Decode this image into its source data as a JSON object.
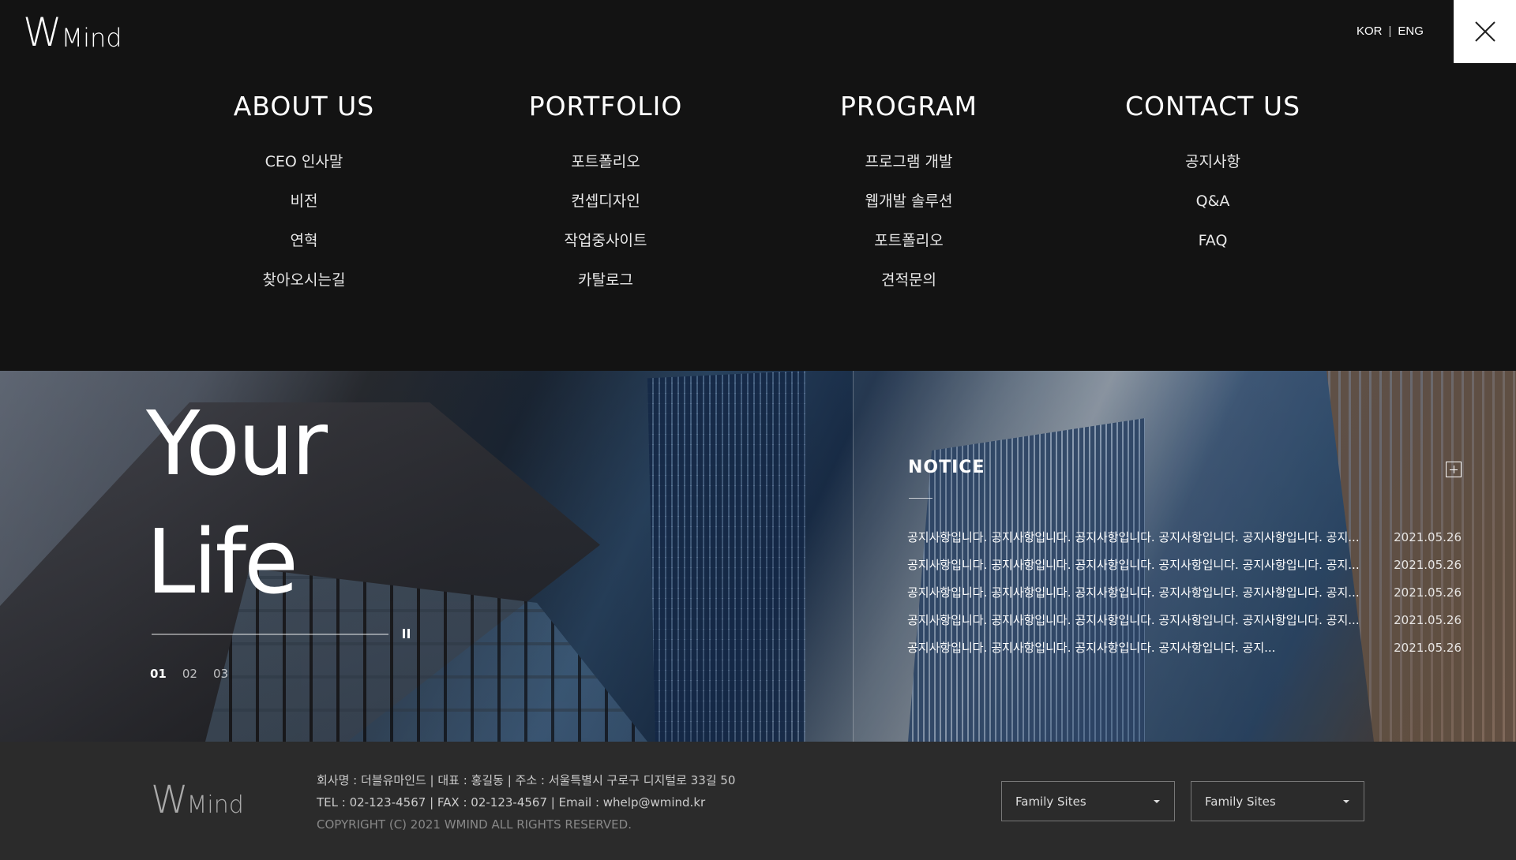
{
  "header": {
    "logo": {
      "w": "W",
      "mind": "Mind"
    },
    "lang": {
      "kor": "KOR",
      "sep": "|",
      "eng": "ENG"
    }
  },
  "menu": {
    "about": {
      "title": "ABOUT US",
      "items": [
        "CEO 인사말",
        "비전",
        "연혁",
        "찾아오시는길"
      ]
    },
    "portfolio": {
      "title": "PORTFOLIO",
      "items": [
        "포트폴리오",
        "컨셉디자인",
        "작업중사이트",
        "카탈로그"
      ]
    },
    "program": {
      "title": "PROGRAM",
      "items": [
        "프로그램 개발",
        "웹개발 솔루션",
        "포트폴리오",
        "견적문의"
      ]
    },
    "contact": {
      "title": "CONTACT US",
      "items": [
        "공지사항",
        "Q&A",
        "FAQ"
      ]
    }
  },
  "hero": {
    "title_line1": "Your",
    "title_line2": "Life",
    "progress_fraction": 0.0,
    "pager": [
      "01",
      "02",
      "03"
    ]
  },
  "notice": {
    "title": "NOTICE",
    "items": [
      {
        "text": "공지사항입니다. 공지사항입니다. 공지사항입니다. 공지사항입니다.  공지사항입니다.  공지...",
        "date": "2021.05.26"
      },
      {
        "text": "공지사항입니다. 공지사항입니다. 공지사항입니다. 공지사항입니다.  공지사항입니다. 공지...",
        "date": "2021.05.26"
      },
      {
        "text": "공지사항입니다. 공지사항입니다. 공지사항입니다. 공지사항입니다.  공지사항입니다. 공지...",
        "date": "2021.05.26"
      },
      {
        "text": "공지사항입니다. 공지사항입니다. 공지사항입니다. 공지사항입니다.  공지사항입니다. 공지...",
        "date": "2021.05.26"
      },
      {
        "text": "공지사항입니다. 공지사항입니다. 공지사항입니다. 공지사항입니다.  공지...",
        "date": "2021.05.26"
      }
    ]
  },
  "footer": {
    "logo": {
      "w": "W",
      "mind": "Mind"
    },
    "line1": "회사명 : 더블유마인드  |  대표 : 홍길동  |  주소 : 서울특별시 구로구 디지털로 33길 50",
    "line2": "TEL : 02-123-4567  |  FAX : 02-123-4567  |  Email : whelp@wmind.kr",
    "copyright": "COPYRIGHT (C) 2021 WMIND ALL RIGHTS RESERVED.",
    "family_sites_1": "Family Sites",
    "family_sites_2": "Family Sites"
  }
}
